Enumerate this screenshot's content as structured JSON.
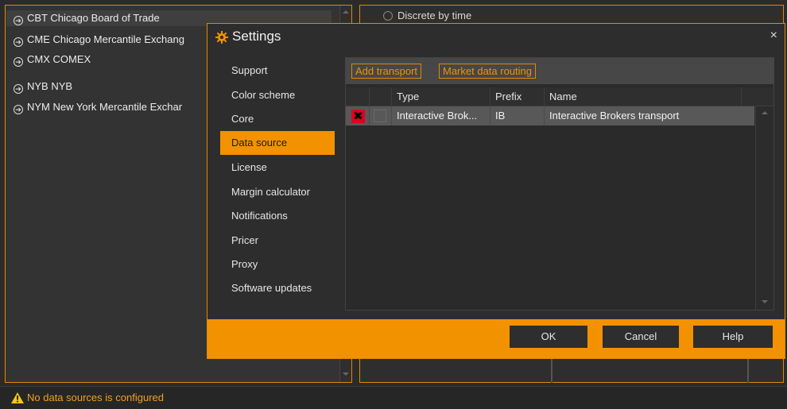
{
  "exchanges": [
    {
      "label": "CBT Chicago Board of Trade"
    },
    {
      "label": "CME Chicago Mercantile Exchang"
    },
    {
      "label": "CMX COMEX"
    },
    {
      "label": "NYB NYB"
    },
    {
      "label": "NYM New York Mercantile Exchar"
    }
  ],
  "background": {
    "radio_label": "Discrete by time"
  },
  "status": {
    "message": "No data sources is configured",
    "icon": "warning-icon"
  },
  "dialog": {
    "title": "Settings",
    "close_label": "×",
    "nav": [
      {
        "label": "Support"
      },
      {
        "label": "Color scheme"
      },
      {
        "label": "Core"
      },
      {
        "label": "Data source",
        "active": true
      },
      {
        "label": "License"
      },
      {
        "label": "Margin calculator"
      },
      {
        "label": "Notifications"
      },
      {
        "label": "Pricer"
      },
      {
        "label": "Proxy"
      },
      {
        "label": "Software updates"
      }
    ],
    "toolbar": {
      "add_transport": "Add transport",
      "market_data_routing": "Market data routing"
    },
    "grid": {
      "columns": [
        "Type",
        "Prefix",
        "Name"
      ],
      "rows": [
        {
          "type": "Interactive Brok...",
          "prefix": "IB",
          "name": "Interactive Brokers transport"
        }
      ]
    },
    "buttons": {
      "ok": "OK",
      "cancel": "Cancel",
      "help": "Help"
    }
  },
  "colors": {
    "accent": "#f39200",
    "delete": "#e3001b"
  }
}
